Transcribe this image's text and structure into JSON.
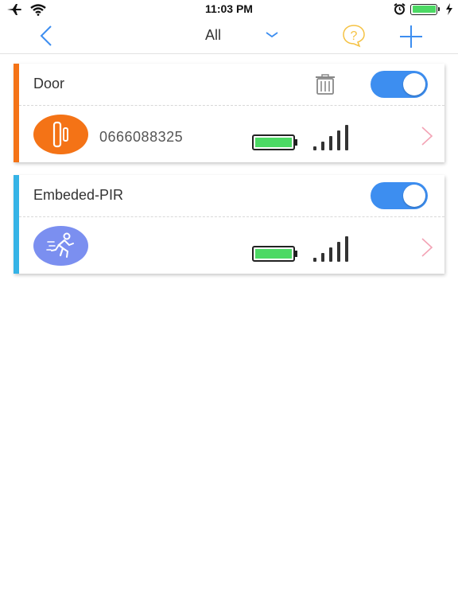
{
  "status_bar": {
    "time": "11:03 PM",
    "icons": [
      "airplane-icon",
      "wifi-icon",
      "alarm-icon",
      "battery-icon",
      "charging-icon"
    ]
  },
  "nav": {
    "title": "All",
    "back_icon": "chevron-left-icon",
    "dropdown_icon": "chevron-down-icon",
    "help_icon": "help-bubble-icon",
    "add_icon": "plus-icon"
  },
  "colors": {
    "primary": "#3d8ef0",
    "door_accent": "#f47316",
    "pir_accent": "#35b3e6",
    "pir_icon_bg": "#7b8ff0",
    "battery_green": "#4cd964",
    "help_yellow": "#f5c243",
    "chevron_pink": "#f3a3b5"
  },
  "devices": [
    {
      "name": "Door",
      "number": "0666088325",
      "icon": "door-sensor-icon",
      "enabled": true,
      "has_delete": true,
      "battery_level": 1.0,
      "signal_bars": 5
    },
    {
      "name": "Embeded-PIR",
      "number": "",
      "icon": "running-person-icon",
      "enabled": true,
      "has_delete": false,
      "battery_level": 1.0,
      "signal_bars": 5
    }
  ]
}
